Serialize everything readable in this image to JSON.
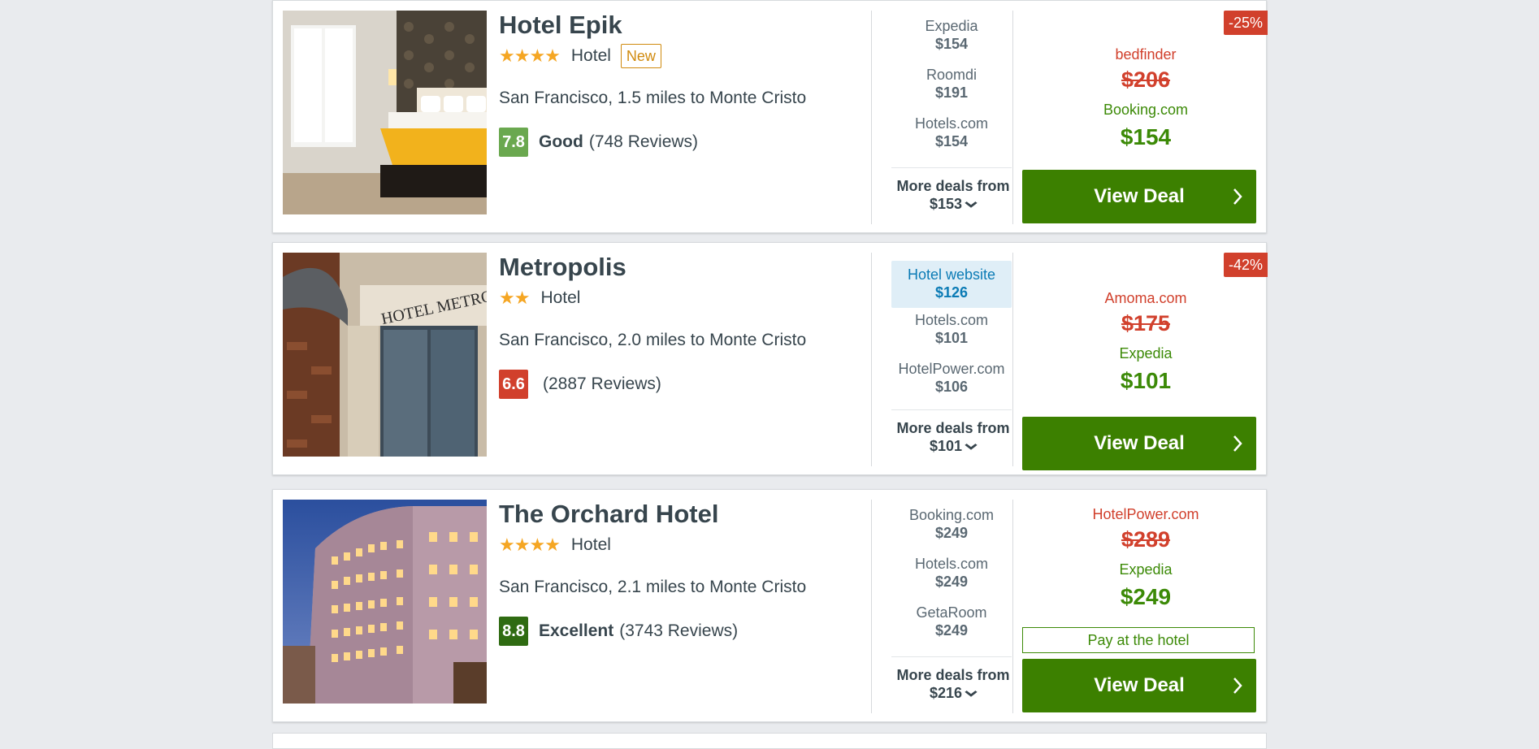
{
  "theme": {
    "score_colors": {
      "good": "#6aa84f",
      "poor": "#d1402c",
      "excellent": "#2f6b12"
    },
    "star_color": "#f5a623",
    "deal_green": "#3c8000",
    "discount_red": "#d1402c"
  },
  "hotels": [
    {
      "name": "Hotel Epik",
      "stars": 4,
      "star_glyphs": "★★★★",
      "type": "Hotel",
      "badge": "New",
      "location": "San Francisco, 1.5 miles to Monte Cristo",
      "score": "7.8",
      "score_label": "Good",
      "reviews": "(748 Reviews)",
      "photo_icon": "hotel-room-photo",
      "deals": [
        {
          "provider": "Expedia",
          "price": "$154",
          "highlighted": false
        },
        {
          "provider": "Roomdi",
          "price": "$191",
          "highlighted": false
        },
        {
          "provider": "Hotels.com",
          "price": "$154",
          "highlighted": false
        }
      ],
      "more_deals_label": "More deals from",
      "more_deals_price": "$153",
      "discount": "-25%",
      "original_provider": "bedfinder",
      "original_price": "$206",
      "best_provider": "Booking.com",
      "best_price": "$154",
      "pay_at_hotel": "",
      "view_deal": "View Deal"
    },
    {
      "name": "Metropolis",
      "stars": 2,
      "star_glyphs": "★★",
      "type": "Hotel",
      "badge": "",
      "location": "San Francisco, 2.0 miles to Monte Cristo",
      "score": "6.6",
      "score_label": "",
      "reviews": "(2887 Reviews)",
      "photo_icon": "hotel-facade-photo",
      "photo_sign": "HOTEL METROPO",
      "deals": [
        {
          "provider": "Hotel website",
          "price": "$126",
          "highlighted": true
        },
        {
          "provider": "Hotels.com",
          "price": "$101",
          "highlighted": false
        },
        {
          "provider": "HotelPower.com",
          "price": "$106",
          "highlighted": false
        }
      ],
      "more_deals_label": "More deals from",
      "more_deals_price": "$101",
      "discount": "-42%",
      "original_provider": "Amoma.com",
      "original_price": "$175",
      "best_provider": "Expedia",
      "best_price": "$101",
      "pay_at_hotel": "",
      "view_deal": "View Deal"
    },
    {
      "name": "The Orchard Hotel",
      "stars": 4,
      "star_glyphs": "★★★★",
      "type": "Hotel",
      "badge": "",
      "location": "San Francisco, 2.1 miles to Monte Cristo",
      "score": "8.8",
      "score_label": "Excellent",
      "reviews": "(3743 Reviews)",
      "photo_icon": "hotel-building-photo",
      "deals": [
        {
          "provider": "Booking.com",
          "price": "$249",
          "highlighted": false
        },
        {
          "provider": "Hotels.com",
          "price": "$249",
          "highlighted": false
        },
        {
          "provider": "GetaRoom",
          "price": "$249",
          "highlighted": false
        }
      ],
      "more_deals_label": "More deals from",
      "more_deals_price": "$216",
      "discount": "",
      "original_provider": "HotelPower.com",
      "original_price": "$289",
      "best_provider": "Expedia",
      "best_price": "$249",
      "pay_at_hotel": "Pay at the hotel",
      "view_deal": "View Deal"
    }
  ]
}
